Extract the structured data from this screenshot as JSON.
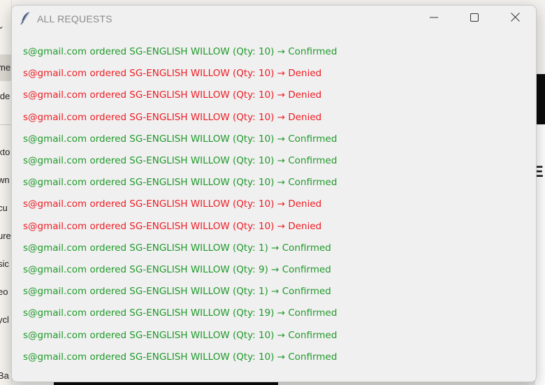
{
  "window": {
    "title": "ALL REQUESTS",
    "icon": "feather-icon"
  },
  "controls": {
    "minimize_icon": "minimize-icon",
    "maximize_icon": "maximize-icon",
    "close_icon": "close-icon"
  },
  "colors": {
    "confirmed": "#1f9a2a",
    "denied": "#ee1d24"
  },
  "requests": [
    {
      "text": "s@gmail.com ordered SG-ENGLISH WILLOW (Qty: 10) → Confirmed",
      "status": "confirmed"
    },
    {
      "text": "s@gmail.com ordered SG-ENGLISH WILLOW (Qty: 10) → Denied",
      "status": "denied"
    },
    {
      "text": "s@gmail.com ordered SG-ENGLISH WILLOW (Qty: 10) → Denied",
      "status": "denied"
    },
    {
      "text": "s@gmail.com ordered SG-ENGLISH WILLOW (Qty: 10) → Denied",
      "status": "denied"
    },
    {
      "text": "s@gmail.com ordered SG-ENGLISH WILLOW (Qty: 10) → Confirmed",
      "status": "confirmed"
    },
    {
      "text": "s@gmail.com ordered SG-ENGLISH WILLOW (Qty: 10) → Confirmed",
      "status": "confirmed"
    },
    {
      "text": "s@gmail.com ordered SG-ENGLISH WILLOW (Qty: 10) → Confirmed",
      "status": "confirmed"
    },
    {
      "text": "s@gmail.com ordered SG-ENGLISH WILLOW (Qty: 10) → Denied",
      "status": "denied"
    },
    {
      "text": "s@gmail.com ordered SG-ENGLISH WILLOW (Qty: 10) → Denied",
      "status": "denied"
    },
    {
      "text": "s@gmail.com ordered SG-ENGLISH WILLOW (Qty: 1) → Confirmed",
      "status": "confirmed"
    },
    {
      "text": "s@gmail.com ordered SG-ENGLISH WILLOW (Qty: 9) → Confirmed",
      "status": "confirmed"
    },
    {
      "text": "s@gmail.com ordered SG-ENGLISH WILLOW (Qty: 1) → Confirmed",
      "status": "confirmed"
    },
    {
      "text": "s@gmail.com ordered SG-ENGLISH WILLOW (Qty: 19) → Confirmed",
      "status": "confirmed"
    },
    {
      "text": "s@gmail.com ordered SG-ENGLISH WILLOW (Qty: 10) → Confirmed",
      "status": "confirmed"
    },
    {
      "text": "s@gmail.com ordered SG-ENGLISH WILLOW (Qty: 10) → Confirmed",
      "status": "confirmed"
    }
  ],
  "background_app": {
    "left_fragments": [
      "me",
      "ide",
      "kto",
      "wn",
      "cu",
      "ure",
      "sic",
      "eo",
      "ycl",
      "Ba"
    ],
    "right_fragment": "E"
  }
}
